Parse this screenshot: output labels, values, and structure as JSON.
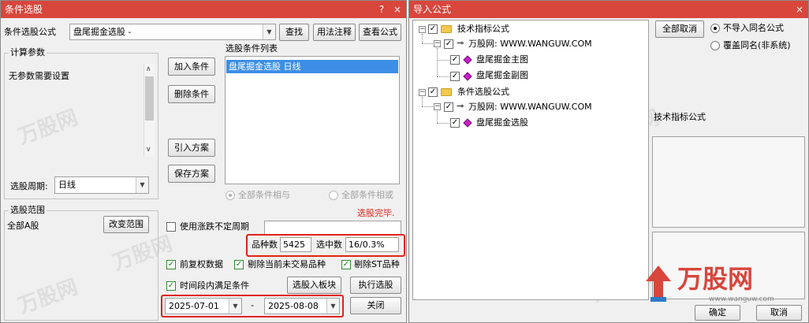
{
  "left_window": {
    "title": "条件选股",
    "title_buttons": [
      "?",
      "×"
    ],
    "formula_label": "条件选股公式",
    "formula_value": "盘尾掘金选股  -",
    "buttons": {
      "find": "查找",
      "usage": "用法注释",
      "view": "查看公式"
    },
    "params_group": {
      "title": "计算参数",
      "text": "无参数需要设置"
    },
    "period_label": "选股周期:",
    "period_value": "日线",
    "range_group": {
      "title": "选股范围",
      "value": "全部A股",
      "change_button": "改变范围"
    },
    "action_buttons": {
      "add": "加入条件",
      "delete": "删除条件",
      "import": "引入方案",
      "save": "保存方案"
    },
    "condition_list": {
      "title": "选股条件列表",
      "items": [
        "盘尾掘金选股  日线"
      ]
    },
    "radio_and": "全部条件相与",
    "radio_or": "全部条件相或",
    "status": "选股完毕.",
    "unfixed_period_label": "使用涨跌不定周期",
    "count_label": "品种数",
    "count_value": "5425",
    "selected_label": "选中数",
    "selected_value": "16/0.3%",
    "checks": {
      "fq": "前复权数据",
      "exclude_untraded": "剔除当前未交易品种",
      "exclude_st": "剔除ST品种",
      "timespan": "时间段内满足条件"
    },
    "to_block_button": "选股入板块",
    "execute_button": "执行选股",
    "date_from": "2025-07-01",
    "date_sep": "-",
    "date_to": "2025-08-08",
    "close_button": "关闭"
  },
  "right_window": {
    "title": "导入公式",
    "title_buttons": [
      "×"
    ],
    "tree": {
      "root1": "技术指标公式",
      "site1": "万股网: WWW.WANGUW.COM",
      "item1": "盘尾掘金主图",
      "item2": "盘尾掘金副图",
      "root2": "条件选股公式",
      "site2": "万股网: WWW.WANGUW.COM",
      "item3": "盘尾掘金选股"
    },
    "cancel_all_button": "全部取消",
    "radio_no_import": "不导入同名公式",
    "radio_overwrite": "覆盖同名(非系统)",
    "info_title": "技术指标公式",
    "ok_button": "确定",
    "cancel_button": "取消",
    "logo_text": "万股网",
    "logo_url": "www.wanguw.com"
  },
  "watermark_text": "万股网",
  "colors": {
    "title_bar": "#d8463c",
    "selection": "#3c8ee6",
    "highlight_box": "#e0231c",
    "status": "#e0231c",
    "logo": "#d8463c"
  }
}
